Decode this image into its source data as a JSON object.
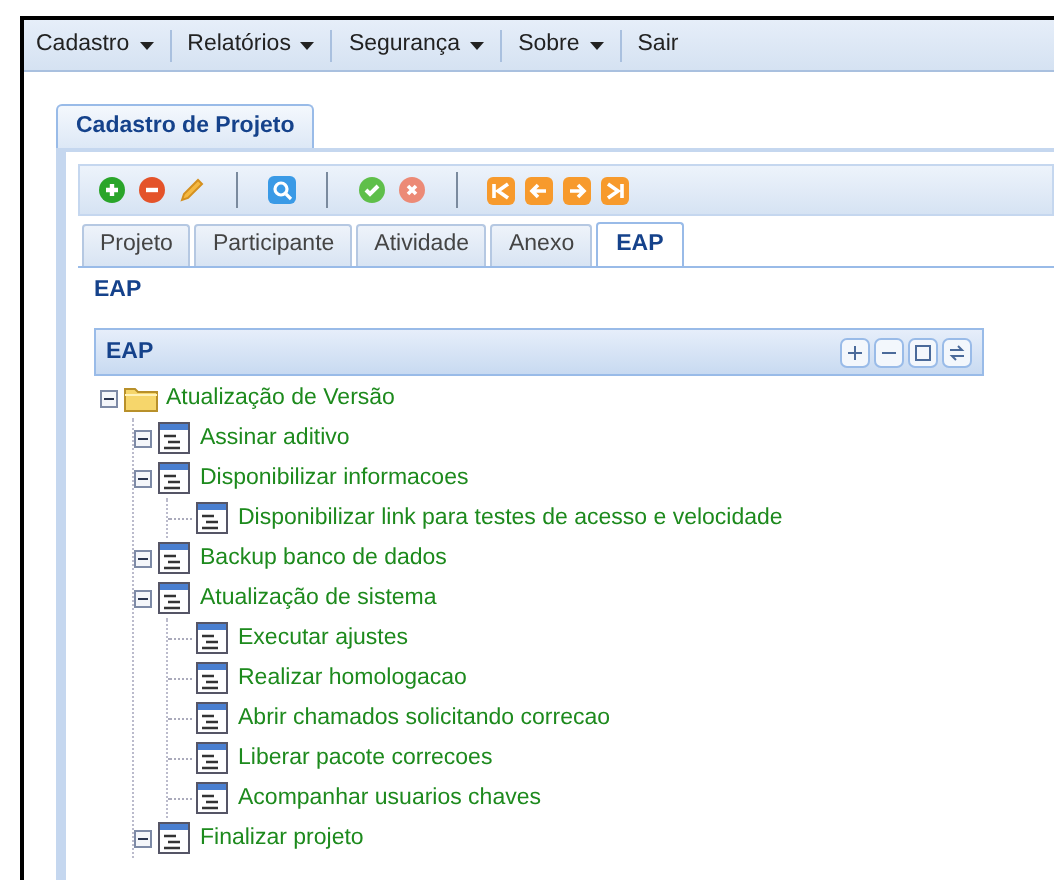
{
  "menu": [
    {
      "label": "Cadastro",
      "dropdown": true
    },
    {
      "label": "Relatórios",
      "dropdown": true
    },
    {
      "label": "Segurança",
      "dropdown": true
    },
    {
      "label": "Sobre",
      "dropdown": true
    },
    {
      "label": "Sair",
      "dropdown": false
    }
  ],
  "window_tab": {
    "label": "Cadastro de Projeto"
  },
  "tabs": [
    {
      "label": "Projeto",
      "selected": false
    },
    {
      "label": "Participante",
      "selected": false
    },
    {
      "label": "Atividade",
      "selected": false
    },
    {
      "label": "Anexo",
      "selected": false
    },
    {
      "label": "EAP",
      "selected": true
    }
  ],
  "section_title": "EAP",
  "tree_panel": {
    "title": "EAP",
    "tree": [
      {
        "label": "Atualização de Versão",
        "kind": "folder",
        "expanded": true,
        "children": [
          {
            "label": "Assinar aditivo",
            "kind": "task",
            "expanded": true
          },
          {
            "label": "Disponibilizar informacoes",
            "kind": "task",
            "expanded": true,
            "children": [
              {
                "label": "Disponibilizar link para testes de acesso e velocidade",
                "kind": "task"
              }
            ]
          },
          {
            "label": "Backup banco de dados",
            "kind": "task",
            "expanded": true
          },
          {
            "label": "Atualização de sistema",
            "kind": "task",
            "expanded": true,
            "children": [
              {
                "label": "Executar ajustes",
                "kind": "task"
              },
              {
                "label": "Realizar homologacao",
                "kind": "task"
              },
              {
                "label": "Abrir chamados solicitando correcao",
                "kind": "task"
              },
              {
                "label": "Liberar pacote correcoes",
                "kind": "task"
              },
              {
                "label": "Acompanhar usuarios chaves",
                "kind": "task"
              }
            ]
          },
          {
            "label": "Finalizar projeto",
            "kind": "task",
            "expanded": true
          }
        ]
      }
    ]
  }
}
